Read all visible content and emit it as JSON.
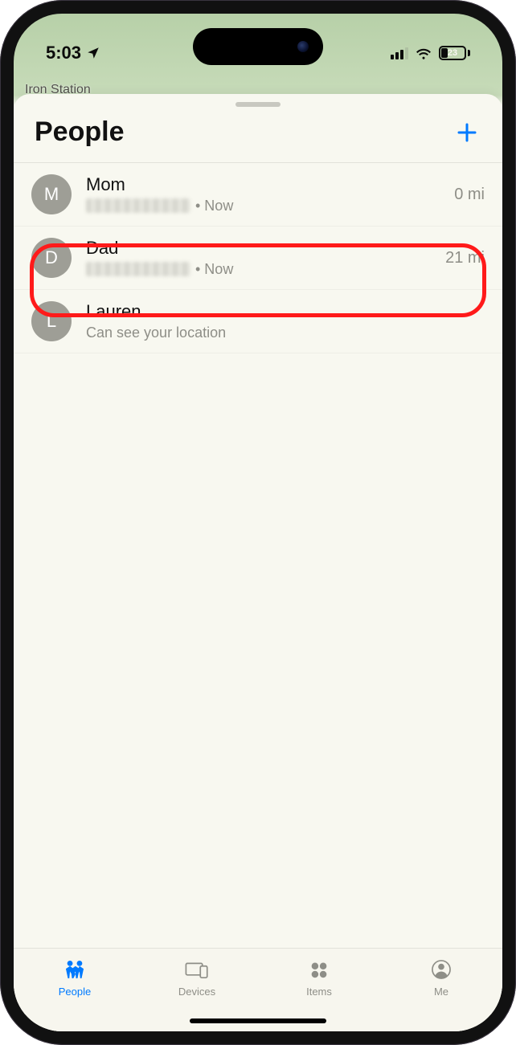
{
  "status": {
    "time": "5:03",
    "battery_text": "23"
  },
  "map": {
    "peek_label": "Iron Station"
  },
  "sheet": {
    "title": "People"
  },
  "people": [
    {
      "initial": "M",
      "name": "Mom",
      "location": "•  Now",
      "has_blurred_location": true,
      "distance": "0 mi",
      "highlighted": false
    },
    {
      "initial": "D",
      "name": "Dad",
      "location": "•  Now",
      "has_blurred_location": true,
      "distance": "21 mi",
      "highlighted": true
    },
    {
      "initial": "L",
      "name": "Lauren",
      "location": "Can see your location",
      "has_blurred_location": false,
      "distance": "",
      "highlighted": false
    }
  ],
  "tabs": {
    "people": "People",
    "devices": "Devices",
    "items": "Items",
    "me": "Me"
  }
}
